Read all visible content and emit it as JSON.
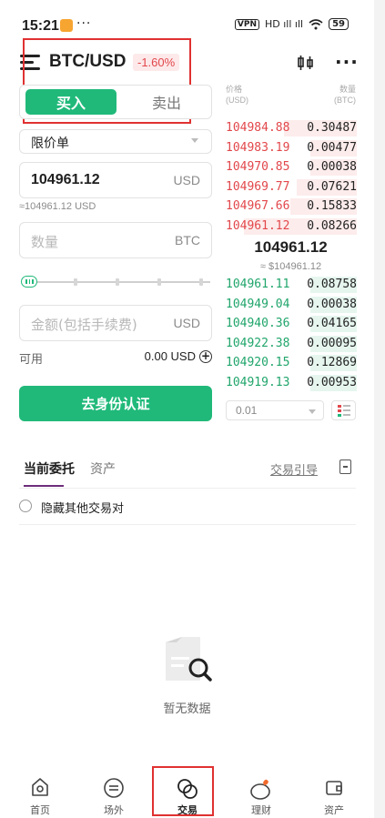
{
  "status_bar": {
    "time": "15:21",
    "more": "···",
    "vpn": "VPN",
    "signal": "HD ıll ıll",
    "battery": "59"
  },
  "header": {
    "pair": "BTC/USD",
    "change": "-1.60%",
    "chart_icon": "candlestick-icon",
    "more_icon": "more-dots-icon"
  },
  "trade_form": {
    "buy_label": "买入",
    "sell_label": "卖出",
    "order_type": "限价单",
    "price_value": "104961.12",
    "price_unit": "USD",
    "price_approx": "≈104961.12 USD",
    "qty_placeholder": "数量",
    "qty_unit": "BTC",
    "slider_level": 0,
    "amount_placeholder": "金额(包括手续费)",
    "amount_unit": "USD",
    "available_label": "可用",
    "available_value": "0.00 USD",
    "kyc_button": "去身份认证"
  },
  "order_book": {
    "price_header": "价格",
    "price_header_unit": "(USD)",
    "qty_header": "数量",
    "qty_header_unit": "(BTC)",
    "asks": [
      {
        "price": "104984.88",
        "qty": "0.30487",
        "depth": 0.55
      },
      {
        "price": "104983.19",
        "qty": "0.00477",
        "depth": 0.35
      },
      {
        "price": "104970.85",
        "qty": "0.00038",
        "depth": 0.35
      },
      {
        "price": "104969.77",
        "qty": "0.07621",
        "depth": 0.45
      },
      {
        "price": "104967.66",
        "qty": "0.15833",
        "depth": 0.5
      },
      {
        "price": "104961.12",
        "qty": "0.08266",
        "depth": 0.85
      }
    ],
    "mid_price": "104961.12",
    "mid_sub": "≈ $104961.12",
    "bids": [
      {
        "price": "104961.11",
        "qty": "0.08758",
        "depth": 0.35
      },
      {
        "price": "104949.04",
        "qty": "0.00038",
        "depth": 0.35
      },
      {
        "price": "104940.36",
        "qty": "0.04165",
        "depth": 0.35
      },
      {
        "price": "104922.38",
        "qty": "0.00095",
        "depth": 0.35
      },
      {
        "price": "104920.15",
        "qty": "0.12869",
        "depth": 0.35
      },
      {
        "price": "104919.13",
        "qty": "0.00953",
        "depth": 0.35
      }
    ],
    "precision": "0.01"
  },
  "orders": {
    "tab_current": "当前委托",
    "tab_assets": "资产",
    "guide": "交易引导",
    "hide_others": "隐藏其他交易对",
    "empty_text": "暂无数据"
  },
  "bottom_nav": [
    {
      "label": "首页",
      "icon": "home-icon"
    },
    {
      "label": "场外",
      "icon": "otc-exchange-icon"
    },
    {
      "label": "交易",
      "icon": "trade-icon"
    },
    {
      "label": "理财",
      "icon": "piggy-bank-icon"
    },
    {
      "label": "资产",
      "icon": "wallet-icon"
    }
  ],
  "colors": {
    "buy_green": "#20b97a",
    "sell_red": "#e2474b",
    "highlight_red": "#e03131"
  }
}
